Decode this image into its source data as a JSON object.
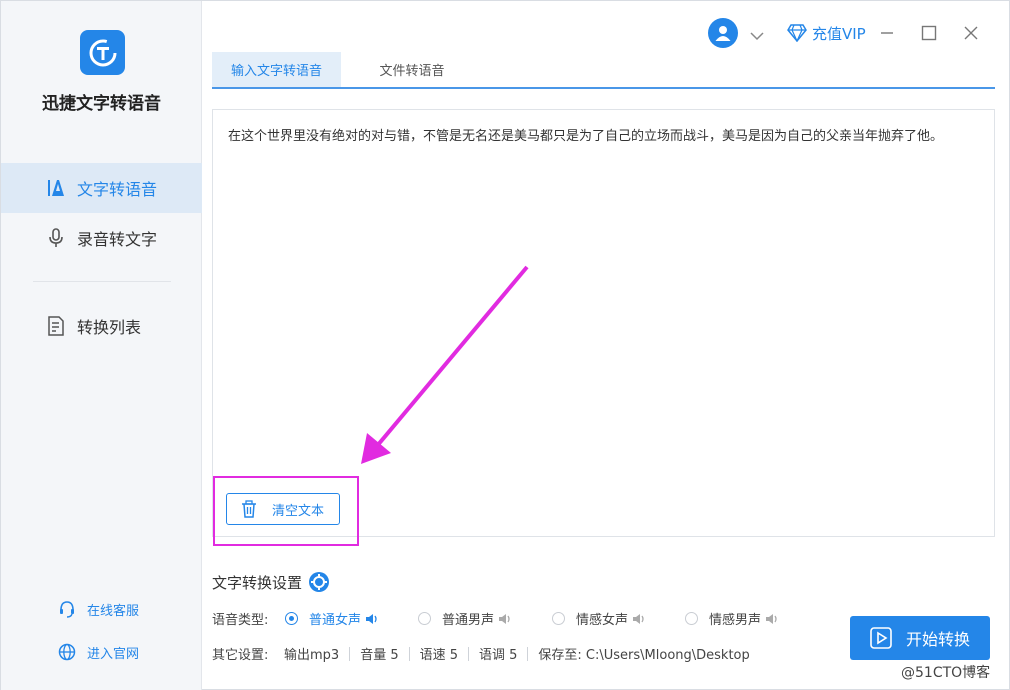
{
  "app": {
    "title": "迅捷文字转语音",
    "logo_letter": "T"
  },
  "sidebar": {
    "items": [
      {
        "label": "文字转语音",
        "icon": "text-a-icon",
        "active": true
      },
      {
        "label": "录音转文字",
        "icon": "microphone-icon",
        "active": false
      },
      {
        "label": "转换列表",
        "icon": "list-document-icon",
        "active": false
      }
    ],
    "footer": [
      {
        "label": "在线客服",
        "icon": "headset-icon"
      },
      {
        "label": "进入官网",
        "icon": "globe-icon"
      }
    ]
  },
  "topbar": {
    "vip_label": "充值VIP"
  },
  "tabs": [
    {
      "label": "输入文字转语音",
      "active": true
    },
    {
      "label": "文件转语音",
      "active": false
    }
  ],
  "editor": {
    "text": "在这个世界里没有绝对的对与错，不管是无名还是美马都只是为了自己的立场而战斗，美马是因为自己的父亲当年抛弃了他。",
    "clear_label": "清空文本"
  },
  "settings": {
    "title": "文字转换设置",
    "voice_type_label": "语音类型:",
    "voices": [
      {
        "label": "普通女声",
        "selected": true
      },
      {
        "label": "普通男声",
        "selected": false
      },
      {
        "label": "情感女声",
        "selected": false
      },
      {
        "label": "情感男声",
        "selected": false
      }
    ],
    "other_label": "其它设置:",
    "other": {
      "output": "输出mp3",
      "volume": "音量 5",
      "speed": "语速 5",
      "pitch": "语调 5",
      "save_to": "保存至: C:\\Users\\Mloong\\Desktop"
    },
    "start_label": "开始转换"
  },
  "watermark": "@51CTO博客",
  "colors": {
    "accent": "#2486e8",
    "annotation": "#e12be0"
  }
}
